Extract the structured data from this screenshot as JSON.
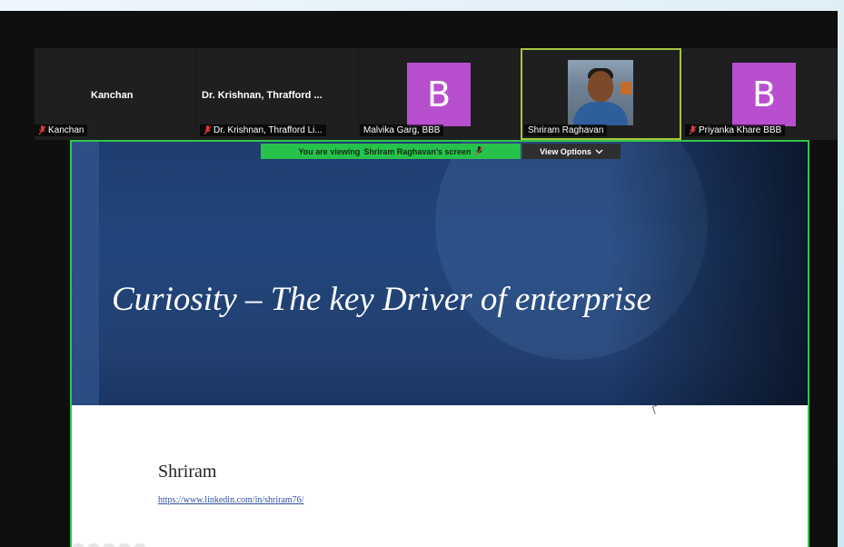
{
  "participants": [
    {
      "tile_name": "Kanchan",
      "label": "Kanchan",
      "muted": true,
      "type": "name"
    },
    {
      "tile_name": "Dr. Krishnan, Thrafford ...",
      "label": "Dr. Krishnan, Thrafford Li...",
      "muted": true,
      "type": "name"
    },
    {
      "avatar_letter": "B",
      "label": "Malvika Garg, BBB",
      "muted": false,
      "type": "avatar"
    },
    {
      "label": "Shriram Raghavan",
      "muted": false,
      "type": "video",
      "active": true
    },
    {
      "avatar_letter": "B",
      "label": "Priyanka Khare BBB",
      "muted": true,
      "type": "avatar"
    }
  ],
  "share": {
    "viewing_prefix": "You are viewing",
    "viewing_name": "Shriram Raghavan's screen",
    "view_options": "View Options"
  },
  "slide": {
    "title": "Curiosity – The key Driver of enterprise",
    "presenter": "Shriram",
    "link": "https://www.linkedin.com/in/shriram76/"
  },
  "colors": {
    "banner_green": "#27c24c",
    "active_outline": "#a4c53a",
    "avatar_purple": "#b84fcf",
    "slide_blue": "#21467c"
  },
  "icons": {
    "muted": "mic-off-icon",
    "dropdown": "chevron-down-icon"
  }
}
